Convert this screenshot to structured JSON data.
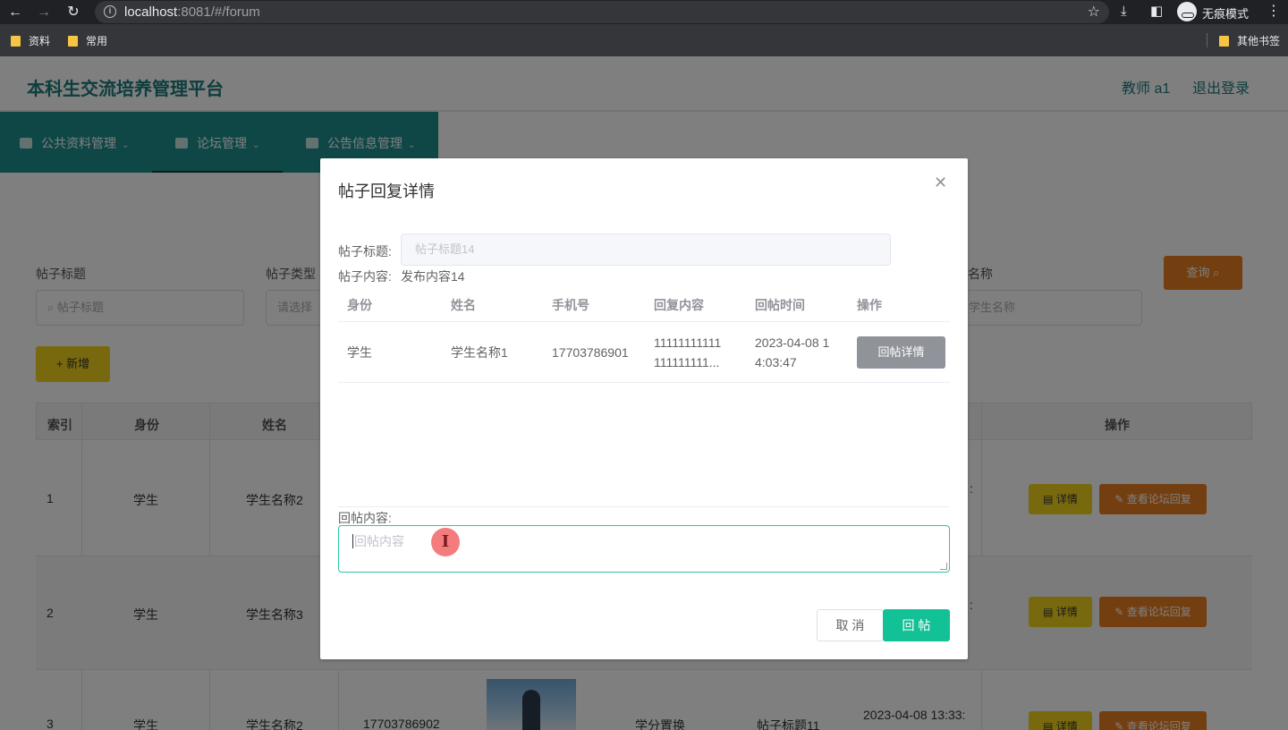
{
  "browser": {
    "url_host": "localhost",
    "url_rest": ":8081/#/forum",
    "incognito_label": "无痕模式",
    "bookmarks": [
      "资料",
      "常用"
    ],
    "other_bookmarks": "其他书签"
  },
  "header": {
    "title": "本科生交流培养管理平台",
    "user": "教师 a1",
    "logout": "退出登录"
  },
  "menu": {
    "items": [
      "公共资料管理",
      "论坛管理",
      "公告信息管理"
    ],
    "active": "论坛管理"
  },
  "filters": {
    "title_label": "帖子标题",
    "title_placeholder": "帖子标题",
    "type_label": "帖子类型",
    "type_placeholder": "请选择",
    "name_label_tail": "名称",
    "name_placeholder_tail": "学生名称",
    "query_label": "查询",
    "add_label": "新增"
  },
  "table": {
    "headers": {
      "index": "索引",
      "role": "身份",
      "name": "姓名",
      "ops": "操作"
    },
    "rows": [
      {
        "index": "1",
        "role": "学生",
        "name": "学生名称2",
        "time": ":"
      },
      {
        "index": "2",
        "role": "学生",
        "name": "学生名称3",
        "time": ":"
      },
      {
        "index": "3",
        "role": "学生",
        "name": "学生名称2",
        "phone": "17703786902",
        "type": "学分置换",
        "title": "帖子标题11",
        "time": "2023-04-08 13:33:"
      }
    ],
    "detail_label": "详情",
    "reply_list_label": "查看论坛回复"
  },
  "dialog": {
    "title": "帖子回复详情",
    "post_title_label": "帖子标题:",
    "post_title_value": "帖子标题14",
    "post_content_label": "帖子内容:",
    "post_content_value": "发布内容14",
    "reply_table": {
      "headers": [
        "身份",
        "姓名",
        "手机号",
        "回复内容",
        "回帖时间",
        "操作"
      ],
      "rows": [
        {
          "role": "学生",
          "name": "学生名称1",
          "phone": "17703786901",
          "content_l1": "11111111111",
          "content_l2": "111111111...",
          "time_l1": "2023-04-08 1",
          "time_l2": "4:03:47",
          "action": "回帖详情"
        }
      ]
    },
    "reply_label": "回帖内容:",
    "reply_placeholder": "回帖内容",
    "cancel_label": "取 消",
    "submit_label": "回 帖"
  }
}
